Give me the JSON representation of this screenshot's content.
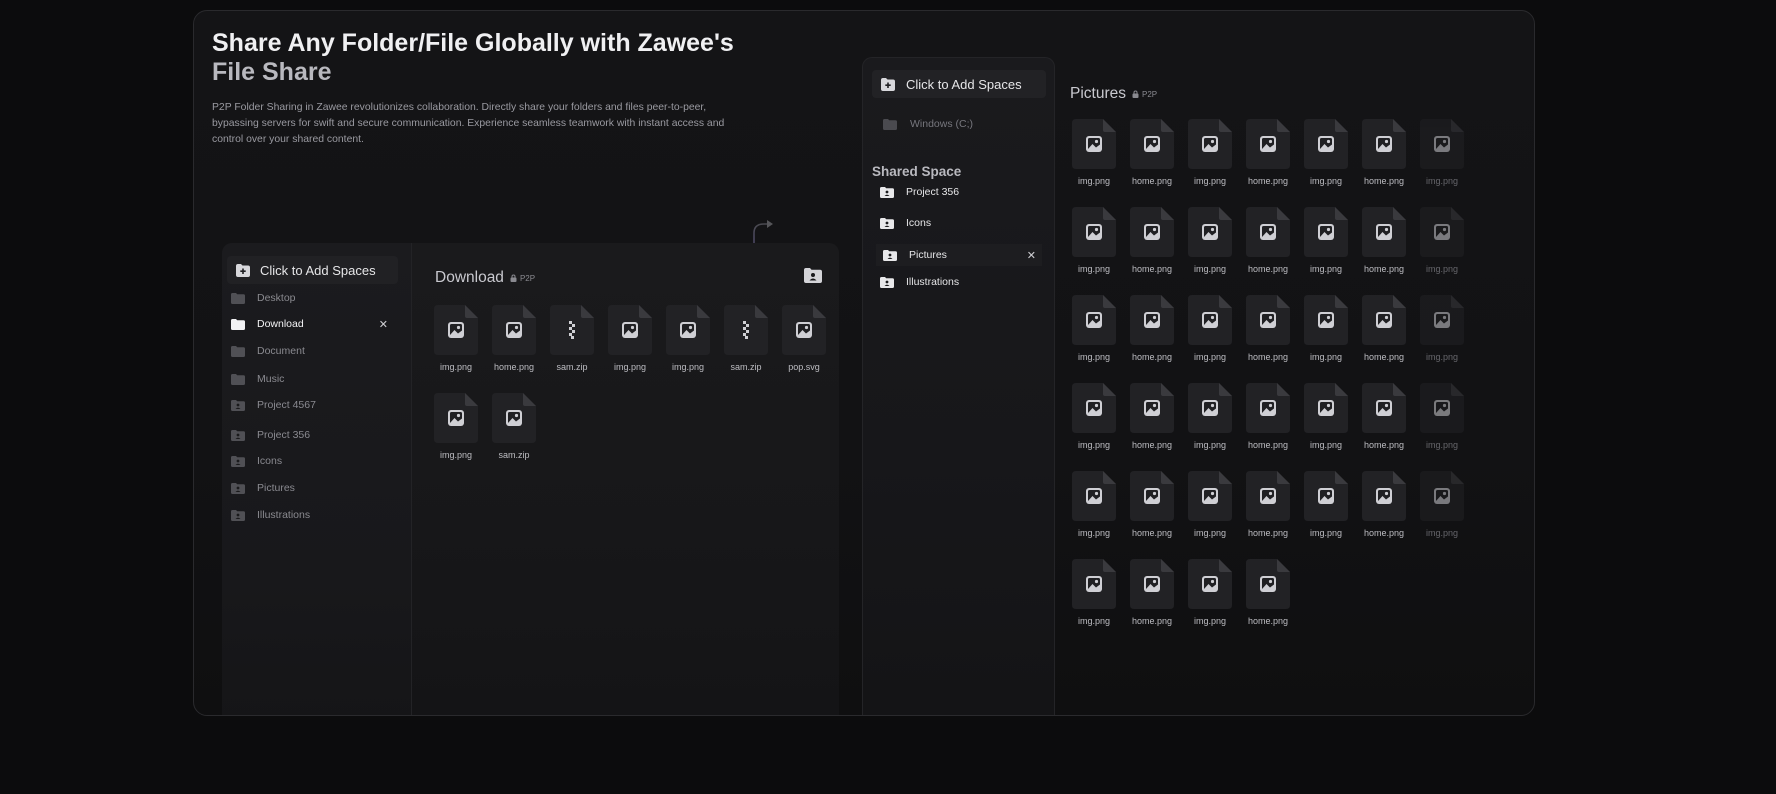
{
  "hero": {
    "title_main": "Share Any Folder/File Globally with Zawee's",
    "title_muted": "File Share",
    "description": "P2P Folder Sharing in Zawee revolutionizes collaboration. Directly share your folders and files peer-to-peer, bypassing servers for swift and secure communication. Experience seamless teamwork with instant access and control over your shared content."
  },
  "left_app": {
    "add_spaces_label": "Click to Add Spaces",
    "sidebar": [
      {
        "label": "Desktop",
        "icon": "folder-icon"
      },
      {
        "label": "Download",
        "icon": "folder-icon",
        "active": true
      },
      {
        "label": "Document",
        "icon": "folder-icon"
      },
      {
        "label": "Music",
        "icon": "folder-icon"
      },
      {
        "label": "Project 4567",
        "icon": "shared-folder-icon"
      },
      {
        "label": "Project 356",
        "icon": "shared-folder-icon"
      },
      {
        "label": "Icons",
        "icon": "shared-folder-icon"
      },
      {
        "label": "Pictures",
        "icon": "shared-folder-icon"
      },
      {
        "label": "Illustrations",
        "icon": "shared-folder-icon"
      }
    ],
    "close_glyph": "✕",
    "folder_title": "Download",
    "badge": "P2P",
    "files": [
      {
        "name": "img.png",
        "type": "image"
      },
      {
        "name": "home.png",
        "type": "image"
      },
      {
        "name": "sam.zip",
        "type": "zip"
      },
      {
        "name": "img.png",
        "type": "image"
      },
      {
        "name": "img.png",
        "type": "image"
      },
      {
        "name": "sam.zip",
        "type": "zip"
      },
      {
        "name": "pop.svg",
        "type": "image"
      },
      {
        "name": "img.png",
        "type": "image"
      },
      {
        "name": "sam.zip",
        "type": "image"
      }
    ]
  },
  "right_app": {
    "add_spaces_label": "Click to Add Spaces",
    "drive_label": "Windows (C;)",
    "shared_space_title": "Shared Space",
    "shared_items": [
      {
        "label": "Project 356"
      },
      {
        "label": "Icons"
      },
      {
        "label": "Pictures",
        "active": true
      },
      {
        "label": "Illustrations"
      }
    ],
    "close_glyph": "✕",
    "folder_title": "Pictures",
    "badge": "P2P",
    "grid_row_names": [
      "img.png",
      "home.png",
      "img.png",
      "home.png",
      "img.png",
      "home.png",
      "img.png"
    ],
    "grid_last_row": [
      "img.png",
      "home.png",
      "img.png",
      "home.png"
    ]
  },
  "colors": {
    "background": "#0c0c0d",
    "card": "#141416",
    "accent": "#7b5cff"
  }
}
